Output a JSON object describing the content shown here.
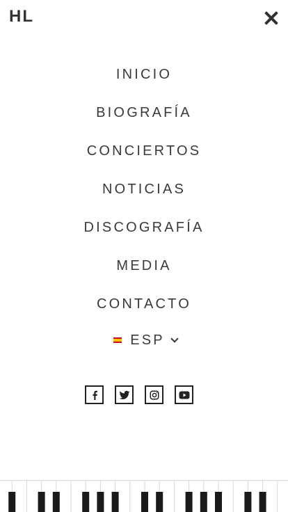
{
  "header": {
    "logo": "HL"
  },
  "menu": {
    "items": [
      {
        "label": "INICIO"
      },
      {
        "label": "BIOGRAFÍA"
      },
      {
        "label": "CONCIERTOS"
      },
      {
        "label": "NOTICIAS"
      },
      {
        "label": "DISCOGRAFÍA"
      },
      {
        "label": "MEDIA"
      },
      {
        "label": "CONTACTO"
      }
    ]
  },
  "language": {
    "selected": "ESP",
    "flag": "spain-flag-icon"
  },
  "social": {
    "icons": [
      "facebook-icon",
      "twitter-icon",
      "instagram-icon",
      "youtube-icon"
    ]
  },
  "colors": {
    "text": "#333333",
    "background": "#ffffff"
  }
}
